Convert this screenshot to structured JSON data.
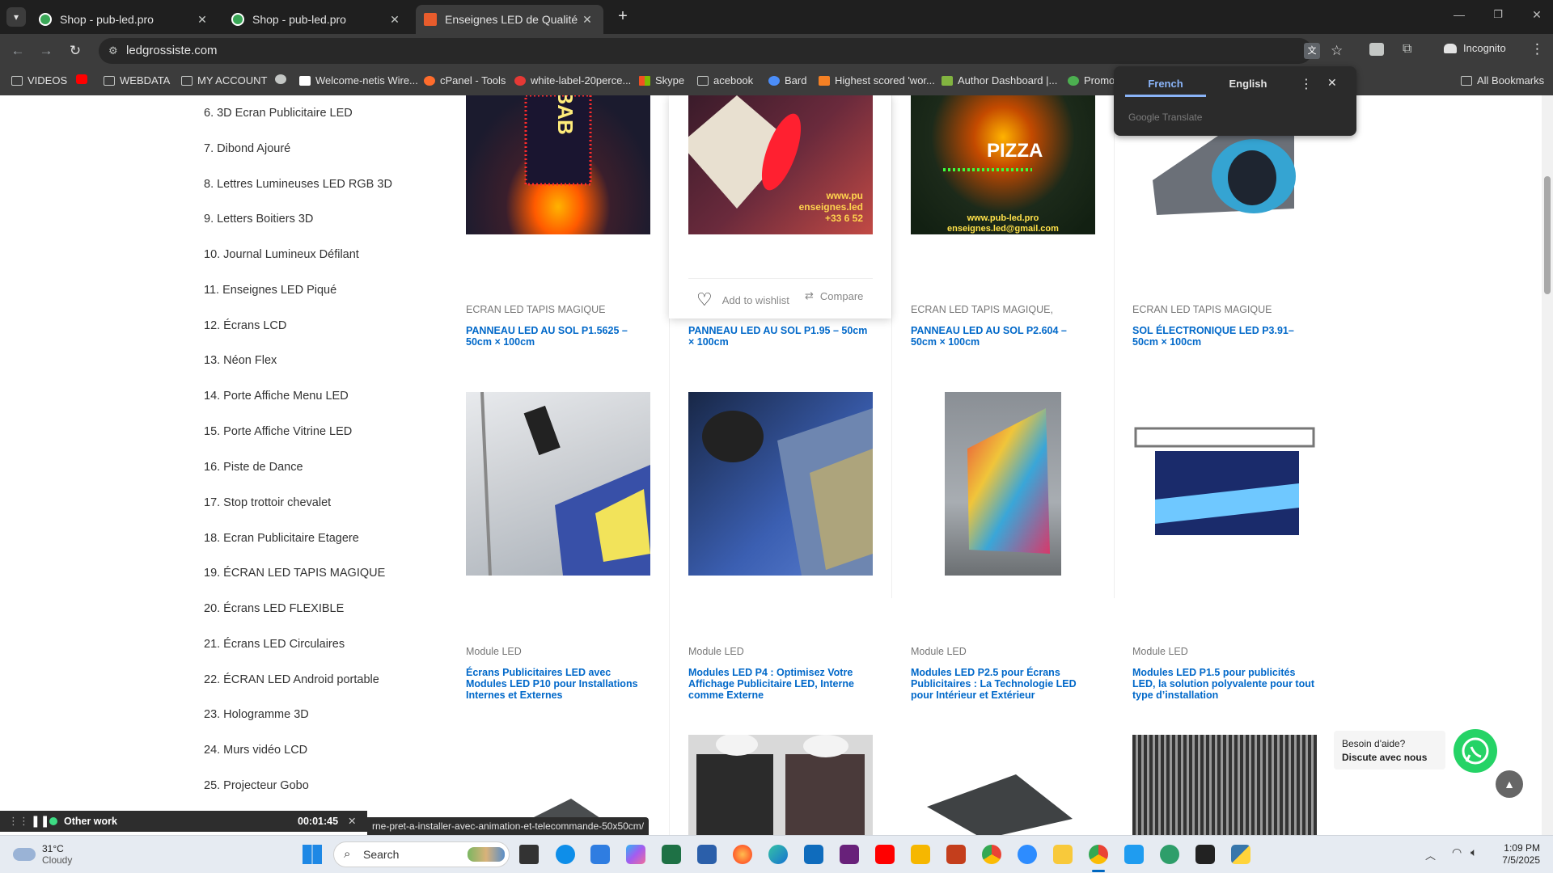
{
  "tabs": [
    {
      "title": "Shop - pub-led.pro",
      "active": false
    },
    {
      "title": "Shop - pub-led.pro",
      "active": false
    },
    {
      "title": "Enseignes LED de Qualité pour",
      "active": true
    }
  ],
  "toolbar": {
    "url": "ledgrossiste.com",
    "incognito": "Incognito"
  },
  "bookmarks": [
    {
      "label": "VIDEOS"
    },
    {
      "label": ""
    },
    {
      "label": "WEBDATA"
    },
    {
      "label": "MY ACCOUNT"
    },
    {
      "label": ""
    },
    {
      "label": "Welcome-netis Wire..."
    },
    {
      "label": "cPanel - Tools"
    },
    {
      "label": "white-label-20perce..."
    },
    {
      "label": "Skype"
    },
    {
      "label": "acebook"
    },
    {
      "label": "Bard"
    },
    {
      "label": "Highest scored 'wor..."
    },
    {
      "label": "Author Dashboard |..."
    },
    {
      "label": "Promo"
    }
  ],
  "all_bookmarks": "All Bookmarks",
  "translate": {
    "lang1": "French",
    "lang2": "English",
    "provider": "Google Translate"
  },
  "categories": [
    "6. 3D Ecran Publicitaire LED",
    "7. Dibond Ajouré",
    "8. Lettres Lumineuses LED RGB 3D",
    "9. Letters Boitiers 3D",
    "10. Journal Lumineux Défilant",
    "11. Enseignes LED Piqué",
    "12. Écrans LCD",
    "13. Néon Flex",
    "14. Porte Affiche Menu LED",
    "15. Porte Affiche Vitrine LED",
    "16. Piste de Dance",
    "17. Stop trottoir chevalet",
    "18. Ecran Publicitaire Etagere",
    "19. ÉCRAN LED TAPIS MAGIQUE",
    "20. Écrans LED FLEXIBLE",
    "21. Écrans LED Circulaires",
    "22. ÉCRAN LED Android portable",
    "23. Hologramme 3D",
    "24. Murs vidéo LCD",
    "25. Projecteur Gobo"
  ],
  "hover_card": {
    "wishlist": "Add to wishlist",
    "compare": "Compare"
  },
  "img_text": {
    "ebab": "EBAB",
    "url1": "www.pu",
    "url2": "enseignes.led",
    "phone": "+33 6 52",
    "pizza": "PIZZA",
    "site": "www.pub-led.pro",
    "email": "enseignes.led@gmail.com"
  },
  "row1": [
    {
      "category": "ECRAN LED TAPIS MAGIQUE",
      "title": "PANNEAU LED AU SOL P1.5625 – 50cm × 100cm"
    },
    {
      "category": "",
      "title": "PANNEAU LED AU SOL P1.95 – 50cm × 100cm"
    },
    {
      "category": "ECRAN LED TAPIS MAGIQUE,",
      "title": "PANNEAU LED AU SOL P2.604 – 50cm × 100cm"
    },
    {
      "category": "ECRAN LED TAPIS MAGIQUE",
      "title": "SOL ÉLECTRONIQUE LED P3.91– 50cm × 100cm"
    }
  ],
  "row2": [
    {
      "category": "Module LED",
      "title": "Écrans Publicitaires LED avec Modules LED P10 pour Installations Internes et Externes"
    },
    {
      "category": "Module LED",
      "title": "Modules LED P4 : Optimisez Votre Affichage Publicitaire LED, Interne comme Externe"
    },
    {
      "category": "Module LED",
      "title": "Modules LED P2.5 pour Écrans Publicitaires : La Technologie LED pour Intérieur et Extérieur"
    },
    {
      "category": "Module LED",
      "title": "Modules LED P1.5 pour publicités LED, la solution polyvalente pour tout type d’installation"
    }
  ],
  "whatsapp": {
    "line1": "Besoin d'aide?",
    "line2": "Discute avec nous"
  },
  "timer": {
    "label": "Other work",
    "time": "00:01:45"
  },
  "status_url": "rne-pret-a-installer-avec-animation-et-telecommande-50x50cm/",
  "taskbar": {
    "temp": "31°C",
    "weather": "Cloudy",
    "search": "Search",
    "time": "1:09 PM",
    "date": "7/5/2025"
  }
}
